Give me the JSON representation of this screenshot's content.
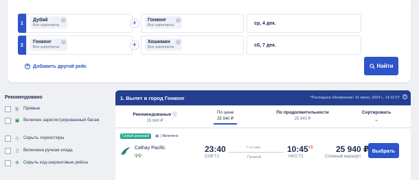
{
  "search": {
    "legs": [
      {
        "number": "1",
        "from_city": "Дубай",
        "from_sub": "Все аэропорты",
        "to_city": "Гонконг",
        "to_sub": "Все аэропорты",
        "date": "ср, 4 дек."
      },
      {
        "number": "2",
        "from_city": "Гонконг",
        "from_sub": "Все аэропорты",
        "to_city": "Хошимин",
        "to_sub": "Все аэропорты",
        "date": "сб, 7 дек."
      }
    ],
    "add_route_label": "Добавить другой рейс",
    "find_label": "Найти",
    "icons": {
      "swap": "plane-icon",
      "remove": "close-icon",
      "find": "search-icon",
      "add": "plus-icon"
    }
  },
  "filters": {
    "title": "Рекомендовано",
    "items": [
      {
        "label": "Прямые",
        "icon": "direct-flight-icon"
      },
      {
        "label": "Включен зарегистрированный багаж",
        "icon": "luggage-icon"
      },
      {
        "label": "Скрыть лоукостеры",
        "icon": "tag-icon"
      },
      {
        "label": "Включена ручная кладь",
        "icon": "bag-icon"
      },
      {
        "label": "Скрыть код-шеринговые рейсы",
        "icon": "codeshare-icon"
      }
    ]
  },
  "results": {
    "title": "1. Вылет в город Гонконг",
    "updated": "*Последнее обновление: 31 июля, 2024 г., 14:22:27",
    "sort_tabs": [
      {
        "label": "Рекомендованые",
        "price": "25 940 ₽",
        "active": false
      },
      {
        "label": "По цене",
        "price": "25 940 ₽",
        "active": true
      },
      {
        "label": "По продолжительности",
        "price": "25 940 ₽",
        "active": false
      },
      {
        "label": "Сортировать",
        "price": "",
        "active": false
      }
    ],
    "flight": {
      "tag_cheap": "Самый дешевый",
      "tag_bag": "Включено",
      "airline": "Cathay Pacific",
      "depart_time": "23:40",
      "depart_airport": "DXB T1",
      "duration": "7 ч 5 мин",
      "stops": "Прямой",
      "arrive_time": "10:45",
      "plus_days": "+1",
      "arrive_airport": "HKG T1",
      "price": "25 940 ₽",
      "route_type": "Сложный маршрут",
      "select_label": "Выбрать"
    }
  },
  "colors": {
    "primary": "#2d54c8",
    "header": "#243f8f",
    "cheap_tag": "#2aa88f",
    "plus_day": "#d23c3c"
  }
}
